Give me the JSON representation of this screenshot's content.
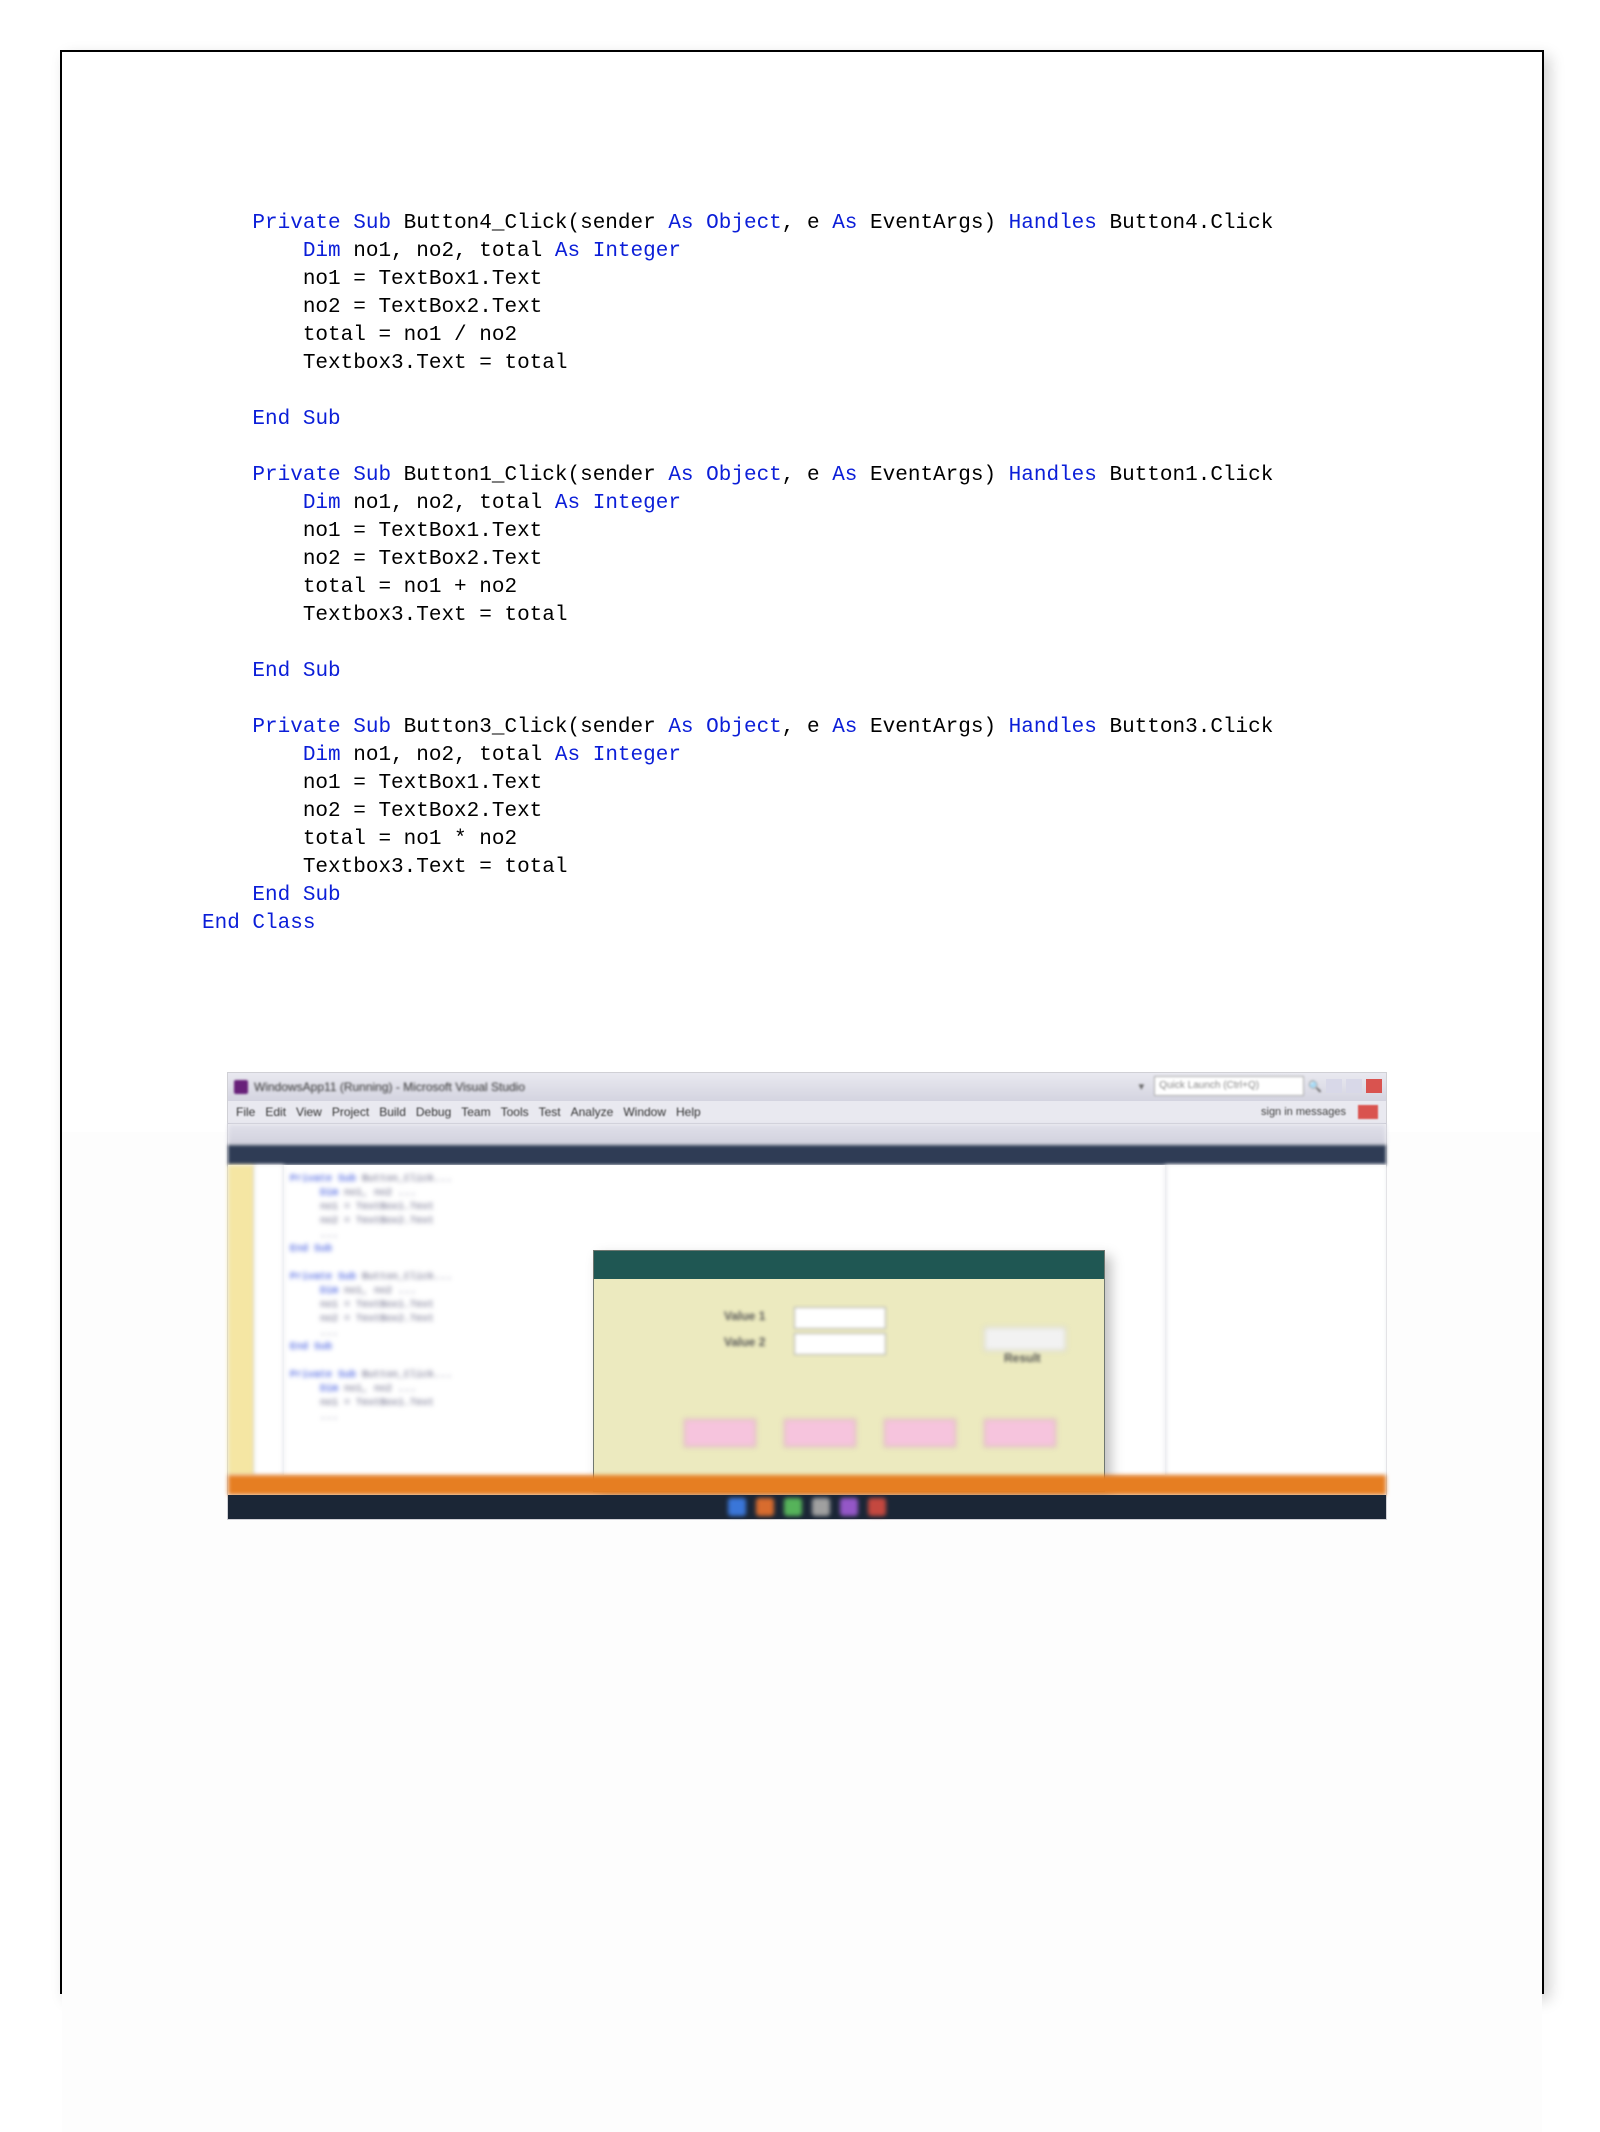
{
  "code": {
    "sub1_header_1": "Private",
    "sub1_header_2": "Sub",
    "sub1_name": "Button4_Click(sender",
    "asKw": "As",
    "objectKw": "Object",
    "sub1_args_mid": ", e ",
    "eventargs": "EventArgs)",
    "handles": "Handles",
    "sub1_handles_target": "Button4.Click",
    "dim": "Dim",
    "dim_vars": " no1, no2, total ",
    "integer": "Integer",
    "sub_body_l1": "no1 = TextBox1.Text",
    "sub_body_l2": "no2 = TextBox2.Text",
    "sub1_body_l3": "total = no1 / no2",
    "sub_body_l4": "Textbox3.Text = total",
    "endSub": "End",
    "subKw": "Sub",
    "sub2_name": "Button1_Click(sender",
    "sub2_handles_target": "Button1.Click",
    "sub2_body_l3": "total = no1 + no2",
    "sub3_name": "Button3_Click(sender",
    "sub3_handles_target": "Button3.Click",
    "sub3_body_l3": "total = no1 * no2",
    "endClass1": "End",
    "endClass2": "Class"
  },
  "ide": {
    "title": "WindowsApp11 (Running) - Microsoft Visual Studio",
    "search_placeholder": "Quick Launch (Ctrl+Q)",
    "signin": "sign in   messages",
    "menu": [
      "File",
      "Edit",
      "View",
      "Project",
      "Build",
      "Debug",
      "Team",
      "Tools",
      "Test",
      "Analyze",
      "Window",
      "Help"
    ]
  },
  "form": {
    "label1": "Value 1",
    "label2": "Value 2",
    "result_label": "Result"
  }
}
